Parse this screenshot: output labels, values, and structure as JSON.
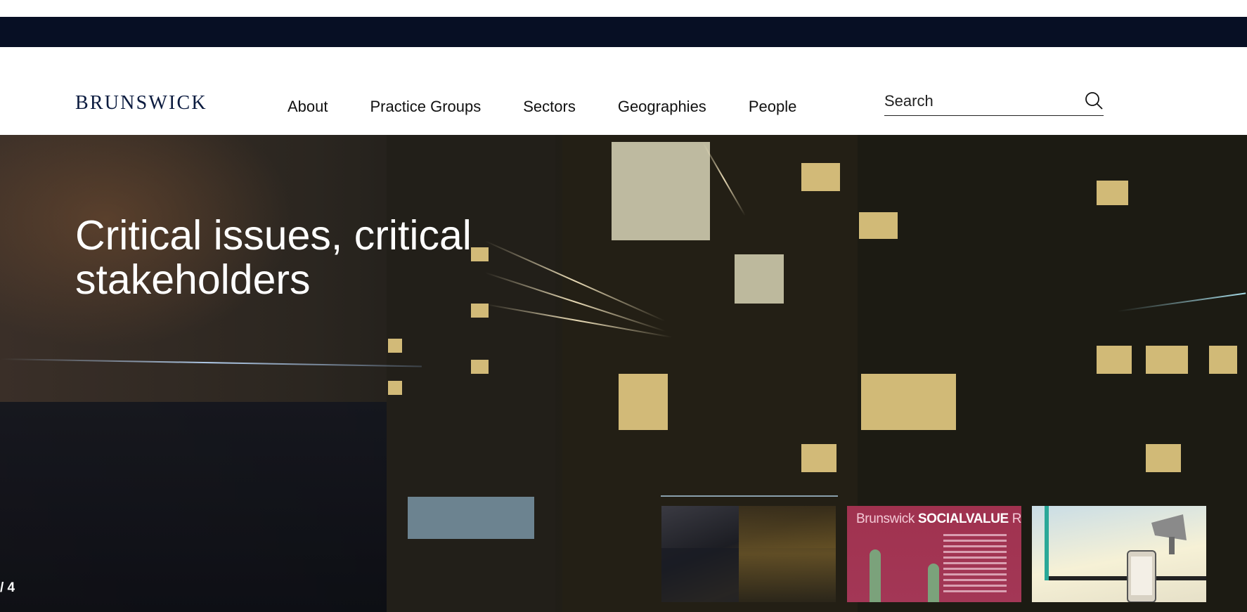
{
  "header": {
    "logo": "BRUNSWICK",
    "nav": [
      "About",
      "Practice Groups",
      "Sectors",
      "Geographies",
      "People"
    ],
    "search": {
      "placeholder": "Search"
    }
  },
  "hero": {
    "title": "Critical issues, critical stakeholders",
    "slide_counter": "/ 4",
    "slide_progress": 1
  },
  "thumbnails": [
    {
      "label": ""
    },
    {
      "label_prefix": "Brunswick",
      "label_bold": "SOCIALVALUE",
      "label_suffix": "Review"
    },
    {
      "label": ""
    }
  ],
  "colors": {
    "topbar": "#070f24",
    "logo": "#0b1b3f",
    "review_cover": "#a0324f"
  }
}
